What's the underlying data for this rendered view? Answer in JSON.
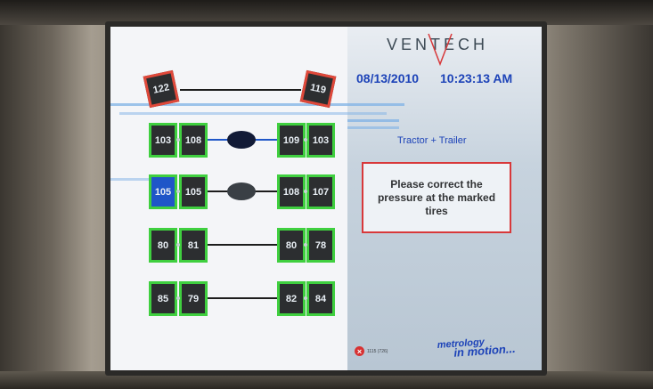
{
  "brand": {
    "name": "VENTECH"
  },
  "header": {
    "date": "08/13/2010",
    "time": "10:23:13 AM"
  },
  "vehicle": {
    "label": "Tractor + Trailer"
  },
  "alert": {
    "message": "Please correct the pressure at the marked tires"
  },
  "tagline": {
    "line1": "metrology",
    "line2": "in motion..."
  },
  "status": {
    "code": "1115 (726)"
  },
  "spare_tires": {
    "left": "122",
    "right": "119"
  },
  "axles": [
    {
      "left_outer": "103",
      "left_inner": "108",
      "right_inner": "109",
      "right_outer": "103"
    },
    {
      "left_outer": "105",
      "left_inner": "105",
      "right_inner": "108",
      "right_outer": "107"
    },
    {
      "left_outer": "80",
      "left_inner": "81",
      "right_inner": "80",
      "right_outer": "78"
    },
    {
      "left_outer": "85",
      "left_inner": "79",
      "right_inner": "82",
      "right_outer": "84"
    }
  ],
  "colors": {
    "ok_border": "#3fcf3f",
    "warn_border": "#e0483a",
    "accent": "#1d43b8"
  }
}
